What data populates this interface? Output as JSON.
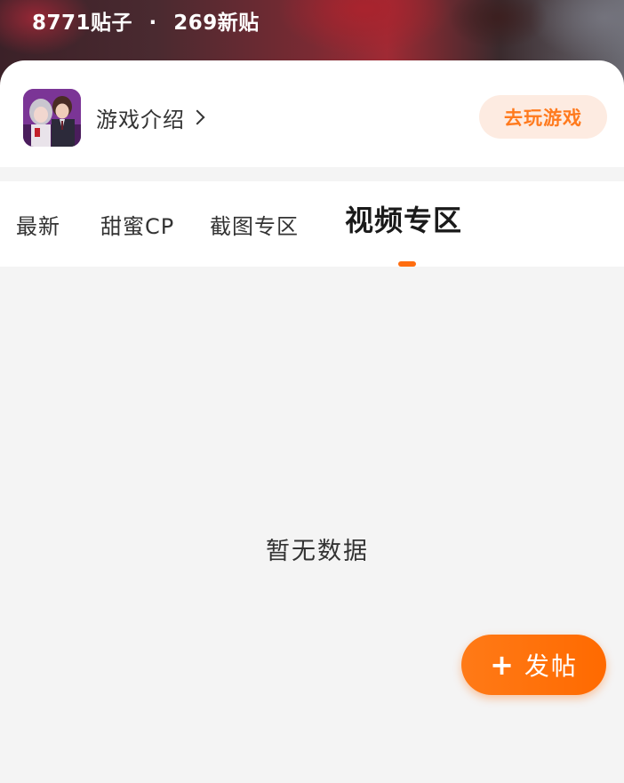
{
  "header": {
    "posts_count": "8771贴子",
    "separator": "·",
    "new_posts": "269新贴"
  },
  "game": {
    "icon": "game-avatar-icon",
    "intro_label": "游戏介绍",
    "play_label": "去玩游戏"
  },
  "tabs": [
    {
      "label": "最新",
      "active": false
    },
    {
      "label": "甜蜜CP",
      "active": false
    },
    {
      "label": "截图专区",
      "active": false
    },
    {
      "label": "视频专区",
      "active": true
    }
  ],
  "empty_state": {
    "text": "暂无数据"
  },
  "fab": {
    "icon": "plus-icon",
    "label": "发帖"
  },
  "colors": {
    "accent": "#ff6d0f",
    "play_button_bg": "#fdebe1",
    "page_bg": "#f4f4f4"
  }
}
